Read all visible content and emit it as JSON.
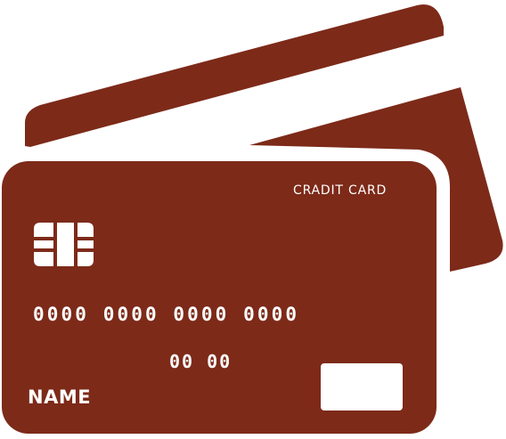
{
  "colors": {
    "card": "#7d2a19",
    "ink": "#ffffff",
    "background": "#ffffff"
  },
  "card": {
    "brand_label": "CRADIT CARD",
    "number": "0000 0000 0000 0000",
    "expiry": "00 00",
    "holder_name": "NAME"
  },
  "icons": {
    "chip": "chip-icon",
    "signature_box": "signature-box"
  }
}
